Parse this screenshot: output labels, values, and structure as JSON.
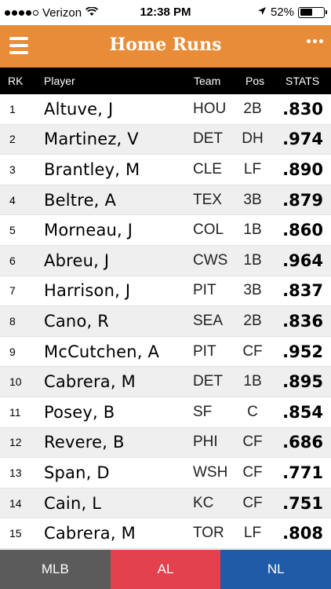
{
  "status_bar": {
    "carrier": "Verizon",
    "time": "12:38 PM",
    "battery": "52%",
    "wifi_icon": "wifi-icon",
    "location_icon": "location-arrow-icon"
  },
  "nav": {
    "title": "Home Runs",
    "menu_icon": "hamburger-menu-icon",
    "more_icon": "more-dots-icon",
    "color": "#e98c37"
  },
  "columns": {
    "rk": "RK",
    "player": "Player",
    "team": "Team",
    "pos": "Pos",
    "stats": "STATS"
  },
  "rows": [
    {
      "rk": "1",
      "player": "Altuve, J",
      "team": "HOU",
      "pos": "2B",
      "stats": ".830"
    },
    {
      "rk": "2",
      "player": "Martinez, V",
      "team": "DET",
      "pos": "DH",
      "stats": ".974"
    },
    {
      "rk": "3",
      "player": "Brantley, M",
      "team": "CLE",
      "pos": "LF",
      "stats": ".890"
    },
    {
      "rk": "4",
      "player": "Beltre, A",
      "team": "TEX",
      "pos": "3B",
      "stats": ".879"
    },
    {
      "rk": "5",
      "player": "Morneau, J",
      "team": "COL",
      "pos": "1B",
      "stats": ".860"
    },
    {
      "rk": "6",
      "player": "Abreu, J",
      "team": "CWS",
      "pos": "1B",
      "stats": ".964"
    },
    {
      "rk": "7",
      "player": "Harrison, J",
      "team": "PIT",
      "pos": "3B",
      "stats": ".837"
    },
    {
      "rk": "8",
      "player": "Cano, R",
      "team": "SEA",
      "pos": "2B",
      "stats": ".836"
    },
    {
      "rk": "9",
      "player": "McCutchen, A",
      "team": "PIT",
      "pos": "CF",
      "stats": ".952"
    },
    {
      "rk": "10",
      "player": "Cabrera, M",
      "team": "DET",
      "pos": "1B",
      "stats": ".895"
    },
    {
      "rk": "11",
      "player": "Posey, B",
      "team": "SF",
      "pos": "C",
      "stats": ".854"
    },
    {
      "rk": "12",
      "player": "Revere, B",
      "team": "PHI",
      "pos": "CF",
      "stats": ".686"
    },
    {
      "rk": "13",
      "player": "Span, D",
      "team": "WSH",
      "pos": "CF",
      "stats": ".771"
    },
    {
      "rk": "14",
      "player": "Cain, L",
      "team": "KC",
      "pos": "CF",
      "stats": ".751"
    },
    {
      "rk": "15",
      "player": "Cabrera, M",
      "team": "TOR",
      "pos": "LF",
      "stats": ".808"
    }
  ],
  "tabs": [
    {
      "label": "MLB",
      "color": "#5b5b5b"
    },
    {
      "label": "AL",
      "color": "#e2414d"
    },
    {
      "label": "NL",
      "color": "#1f5ba6"
    }
  ]
}
